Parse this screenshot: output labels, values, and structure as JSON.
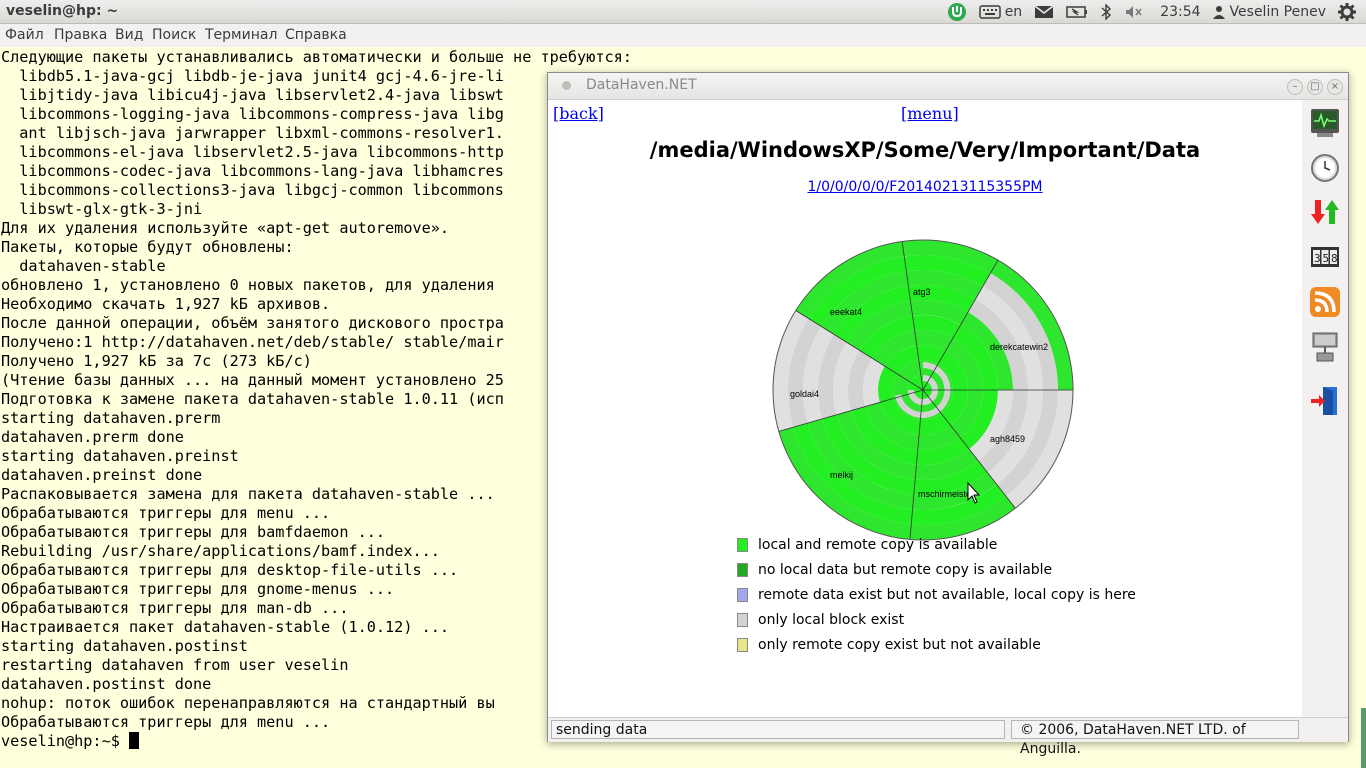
{
  "top_panel": {
    "window_title": "veselin@hp: ~",
    "keyboard_layout": "en",
    "time": "23:54",
    "user": "Veselin Penev",
    "icons": [
      "chat-status-icon",
      "keyboard-icon",
      "mail-icon",
      "battery-icon",
      "bluetooth-icon",
      "volume-muted-icon",
      "gear-icon"
    ]
  },
  "menubar": [
    "Файл",
    "Правка",
    "Вид",
    "Поиск",
    "Терминал",
    "Справка"
  ],
  "terminal": {
    "lines": [
      "Следующие пакеты устанавливались автоматически и больше не требуются:",
      "  libdb5.1-java-gcj libdb-je-java junit4 gcj-4.6-jre-li",
      "  libjtidy-java libicu4j-java libservlet2.4-java libswt",
      "  libcommons-logging-java libcommons-compress-java libg",
      "  ant libjsch-java jarwrapper libxml-commons-resolver1.",
      "  libcommons-el-java libservlet2.5-java libcommons-http",
      "  libcommons-codec-java libcommons-lang-java libhamcres",
      "  libcommons-collections3-java libgcj-common libcommons",
      "  libswt-glx-gtk-3-jni",
      "Для их удаления используйте «apt-get autoremove».",
      "Пакеты, которые будут обновлены:",
      "  datahaven-stable",
      "обновлено 1, установлено 0 новых пакетов, для удаления",
      "Необходимо скачать 1,927 kБ архивов.",
      "После данной операции, объём занятого дискового простра",
      "Получено:1 http://datahaven.net/deb/stable/ stable/mair",
      "Получено 1,927 kБ за 7с (273 kБ/c)",
      "(Чтение базы данных ... на данный момент установлено 25",
      "Подготовка к замене пакета datahaven-stable 1.0.11 (исп",
      "starting datahaven.prerm",
      "datahaven.prerm done",
      "starting datahaven.preinst",
      "datahaven.preinst done",
      "Распаковывается замена для пакета datahaven-stable ...",
      "Обрабатываются триггеры для menu ...",
      "Обрабатываются триггеры для bamfdaemon ...",
      "Rebuilding /usr/share/applications/bamf.index...",
      "Обрабатываются триггеры для desktop-file-utils ...",
      "Обрабатываются триггеры для gnome-menus ...",
      "Обрабатываются триггеры для man-db ...",
      "Настраивается пакет datahaven-stable (1.0.12) ...",
      "starting datahaven.postinst",
      "restarting datahaven from user veselin",
      "datahaven.postinst done",
      "nohup: поток ошибок перенаправляются на стандартный вы",
      "Обрабатываются триггеры для menu ..."
    ],
    "prompt": "veselin@hp:~$ "
  },
  "datahaven": {
    "window_title": "DataHaven.NET",
    "back_link": "[back]",
    "menu_link": "[menu]",
    "path_title": "/media/WindowsXP/Some/Very/Important/Data",
    "backup_id": "1/0/0/0/0/0/F20140213115355PM",
    "suppliers": [
      "atg3",
      "derekcatewin2",
      "agh8459",
      "mschirmeister",
      "melkij",
      "goldai4",
      "eeekat4"
    ],
    "legend": [
      {
        "label": "local and remote copy is available",
        "color": "#22ee22"
      },
      {
        "label": "no local data but remote copy is available",
        "color": "#22aa22"
      },
      {
        "label": "remote data exist but not available, local copy is here",
        "color": "#a6a6ee"
      },
      {
        "label": "only local block exist",
        "color": "#d3d3d3"
      },
      {
        "label": "only remote copy exist but not available",
        "color": "#e6e68a"
      }
    ],
    "status_left": "sending data",
    "status_right": "© 2006, DataHaven.NET LTD. of Anguilla.",
    "sidebar_icons": [
      "monitor-icon",
      "clock-icon",
      "transfer-arrows-icon",
      "counter-icon",
      "rss-icon",
      "network-icon",
      "exit-door-icon"
    ]
  }
}
